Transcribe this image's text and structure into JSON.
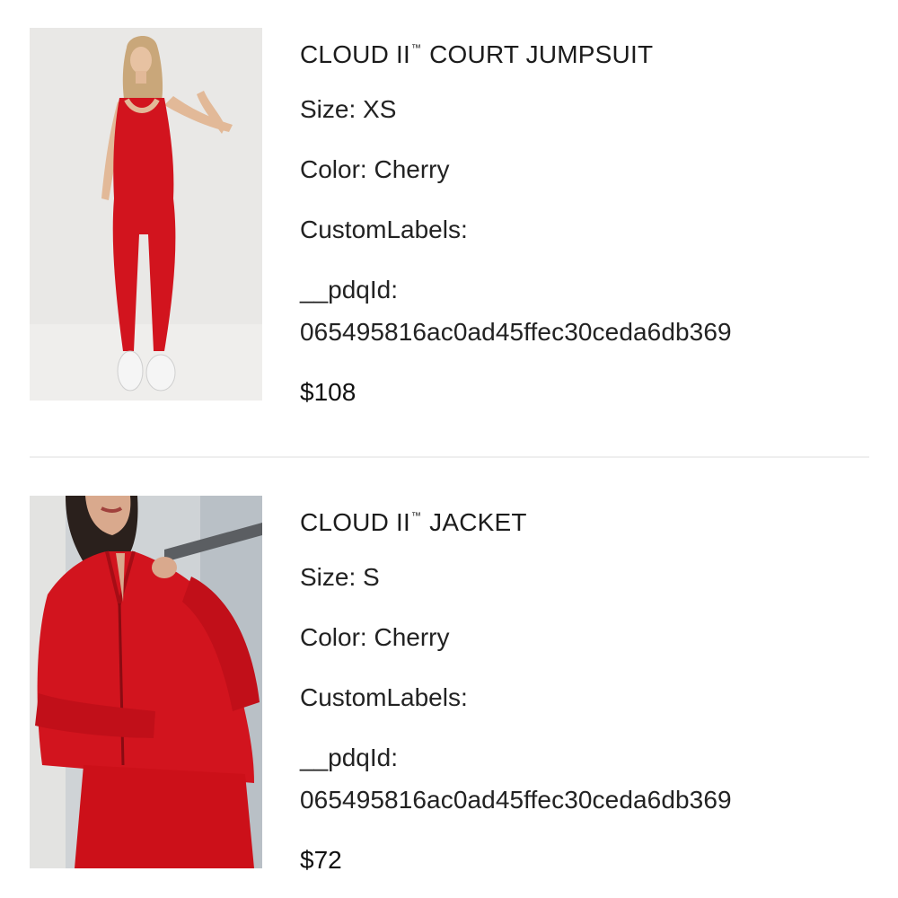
{
  "items": [
    {
      "title_main": "CLOUD II",
      "title_tm": "™",
      "title_rest": " COURT JUMPSUIT",
      "size": "Size: XS",
      "color": "Color: Cherry",
      "custom_labels": "CustomLabels:",
      "pdq_key": "__pdqId:",
      "pdq_value": "065495816ac0ad45ffec30ceda6db369",
      "price": "$108",
      "image_icon": "product-photo-jumpsuit"
    },
    {
      "title_main": "CLOUD II",
      "title_tm": "™",
      "title_rest": " JACKET",
      "size": "Size: S",
      "color": "Color: Cherry",
      "custom_labels": "CustomLabels:",
      "pdq_key": "__pdqId:",
      "pdq_value": "065495816ac0ad45ffec30ceda6db369",
      "price": "$72",
      "image_icon": "product-photo-jacket"
    }
  ],
  "colors": {
    "product_red": "#d2141e",
    "text": "#1c1c1c",
    "divider": "#eeeeee"
  }
}
